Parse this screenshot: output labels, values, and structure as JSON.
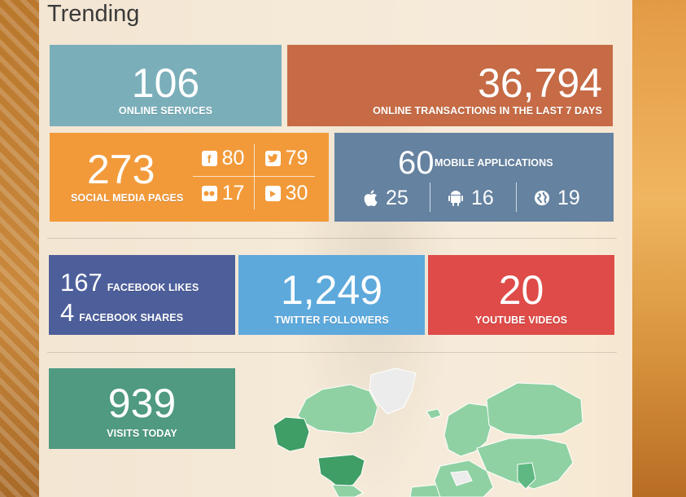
{
  "heading": "Trending",
  "tiles": {
    "online_services": {
      "value": "106",
      "label": "ONLINE SERVICES"
    },
    "transactions": {
      "value": "36,794",
      "label": "ONLINE TRANSACTIONS IN THE LAST 7 DAYS"
    },
    "social_media": {
      "value": "273",
      "label": "SOCIAL MEDIA PAGES",
      "breakdown": [
        {
          "icon": "facebook-icon",
          "value": "80"
        },
        {
          "icon": "twitter-icon",
          "value": "79"
        },
        {
          "icon": "flickr-icon",
          "value": "17"
        },
        {
          "icon": "youtube-icon",
          "value": "30"
        }
      ]
    },
    "mobile_apps": {
      "value": "60",
      "label": "MOBILE APPLICATIONS",
      "breakdown": [
        {
          "icon": "apple-icon",
          "value": "25"
        },
        {
          "icon": "android-icon",
          "value": "16"
        },
        {
          "icon": "globe-icon",
          "value": "19"
        }
      ]
    },
    "facebook": {
      "likes_value": "167",
      "likes_label": "FACEBOOK LIKES",
      "shares_value": "4",
      "shares_label": "FACEBOOK SHARES"
    },
    "twitter": {
      "value": "1,249",
      "label": "TWITTER FOLLOWERS"
    },
    "youtube": {
      "value": "20",
      "label": "YOUTUBE VIDEOS"
    },
    "visits": {
      "value": "939",
      "label": "VISITS TODAY"
    }
  },
  "colors": {
    "online_services": "#7aafba",
    "transactions": "#c66b45",
    "social_media": "#f29a3a",
    "mobile_apps": "#6582a0",
    "facebook": "#4d5f9b",
    "twitter": "#5da9dc",
    "youtube": "#de4b48",
    "visits": "#4f9a80",
    "map_light": "#8fd1a3",
    "map_dark": "#3f9d66",
    "map_none": "#ececec"
  }
}
